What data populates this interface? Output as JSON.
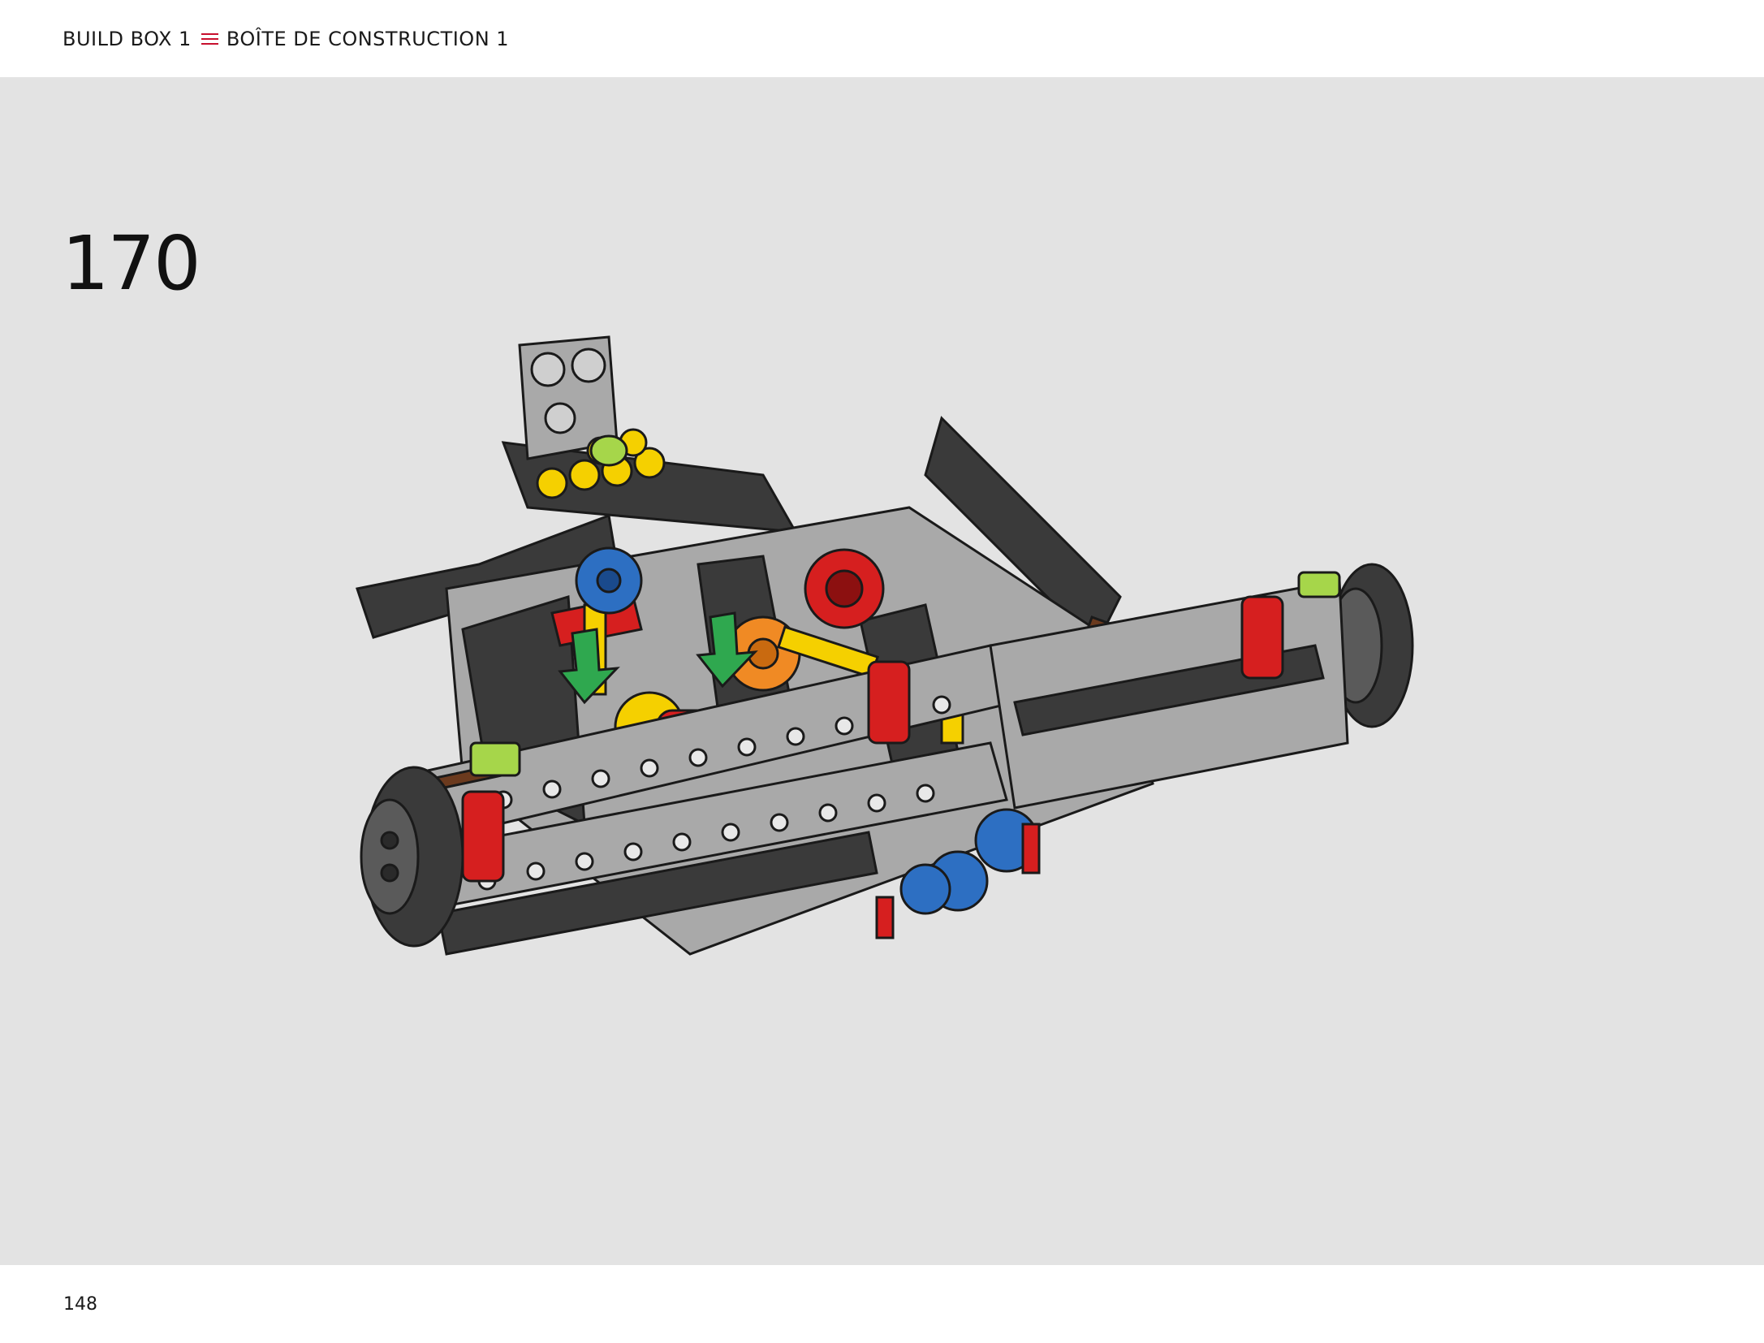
{
  "header": {
    "build_box_en": "BUILD BOX 1",
    "separator_icon": "triple-line-icon",
    "build_box_fr": "BOÎTE DE CONSTRUCTION 1",
    "separator_color": "#c8102e"
  },
  "step": {
    "number": "170"
  },
  "illustration": {
    "subject": "technic-chassis-assembly",
    "arrow_count": 2,
    "arrow_color": "#2fa84f",
    "part_colors": [
      "#3a3a3a",
      "#a9a9a9",
      "#d61f1f",
      "#f5d000",
      "#f08a24",
      "#2d6fc2",
      "#a6d64a",
      "#6b3a1e"
    ]
  },
  "footer": {
    "page_number": "148"
  }
}
